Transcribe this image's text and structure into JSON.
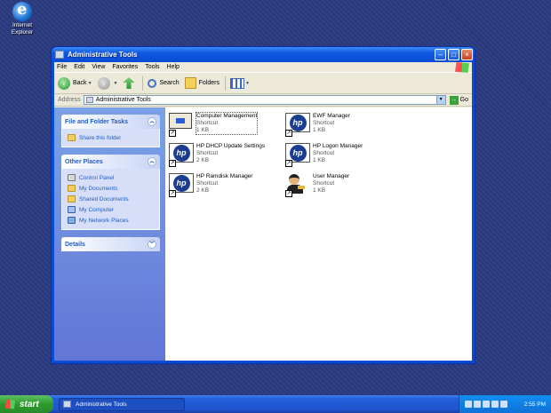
{
  "desktop": {
    "icons": [
      {
        "label_line1": "Internet",
        "label_line2": "Explorer",
        "icon": "internet-explorer-icon"
      }
    ]
  },
  "window": {
    "title": "Administrative Tools",
    "menu": [
      "File",
      "Edit",
      "View",
      "Favorites",
      "Tools",
      "Help"
    ],
    "toolbar": {
      "back": "Back",
      "search": "Search",
      "folders": "Folders"
    },
    "address": {
      "label": "Address",
      "value": "Administrative Tools",
      "go": "Go"
    }
  },
  "taskpane": {
    "file_folder_tasks": {
      "title": "File and Folder Tasks",
      "items": [
        "Share this folder"
      ]
    },
    "other_places": {
      "title": "Other Places",
      "items": [
        "Control Panel",
        "My Documents",
        "Shared Documents",
        "My Computer",
        "My Network Places"
      ]
    },
    "details": {
      "title": "Details"
    }
  },
  "files": [
    {
      "name": "Computer Management",
      "type": "Shortcut",
      "size": "1 KB",
      "icon": "computer-management-icon"
    },
    {
      "name": "EWF Manager",
      "type": "Shortcut",
      "size": "1 KB",
      "icon": "hp-icon"
    },
    {
      "name": "HP DHCP Update Settings",
      "type": "Shortcut",
      "size": "2 KB",
      "icon": "hp-icon"
    },
    {
      "name": "HP Logon Manager",
      "type": "Shortcut",
      "size": "1 KB",
      "icon": "hp-icon"
    },
    {
      "name": "HP Ramdisk Manager",
      "type": "Shortcut",
      "size": "2 KB",
      "icon": "hp-icon"
    },
    {
      "name": "User Manager",
      "type": "Shortcut",
      "size": "1 KB",
      "icon": "user-manager-icon"
    }
  ],
  "taskbar": {
    "start": "start",
    "task": "Administrative Tools",
    "clock": "2:55 PM"
  }
}
